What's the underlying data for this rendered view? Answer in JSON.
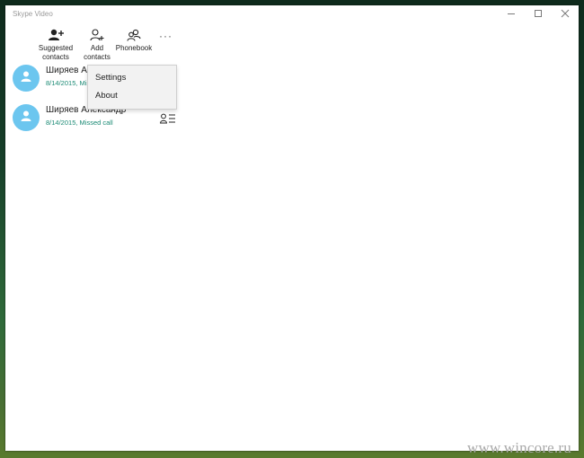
{
  "window": {
    "title": "Skype Video",
    "minimize_icon": "minimize-icon",
    "maximize_icon": "maximize-icon",
    "close_icon": "close-icon"
  },
  "toolbar": {
    "suggested_label_1": "Suggested",
    "suggested_label_2": "contacts",
    "add_label_1": "Add",
    "add_label_2": "contacts",
    "phonebook_label": "Phonebook",
    "more_label": "···"
  },
  "contacts": [
    {
      "name": "Ширяев Ал",
      "status": "8/14/2015, Mis"
    },
    {
      "name": "Ширяев Александр",
      "status": "8/14/2015, Missed call"
    }
  ],
  "menu": {
    "items": [
      {
        "label": "Settings"
      },
      {
        "label": "About"
      }
    ]
  },
  "watermark": "www.wincore.ru",
  "colors": {
    "avatar": "#6cc6ef",
    "status_text": "#1a8a74",
    "menu_bg": "#f2f2f2"
  }
}
